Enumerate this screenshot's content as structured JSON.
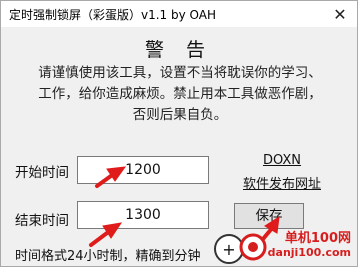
{
  "window": {
    "title": "定时强制锁屏（彩蛋版）v1.1 by OAH",
    "close_glyph": "✕"
  },
  "heading": "警 告",
  "warning_lines": [
    "请谨慎使用该工具，设置不当将耽误你的学习、",
    "工作，给你造成麻烦。禁止用本工具做恶作剧，",
    "否则后果自负。"
  ],
  "start": {
    "label": "开始时间",
    "value": "1200"
  },
  "end": {
    "label": "结束时间",
    "value": "1300"
  },
  "link": {
    "line1": "DOXN",
    "line2": "软件发布网址"
  },
  "save_label": "保存",
  "hint": "时间格式24小时制，精确到分钟",
  "watermark": {
    "text": "单机100网",
    "sub": "danji100.com"
  },
  "colors": {
    "arrow": "#e01b1b",
    "watermark": "#d71e1e"
  }
}
